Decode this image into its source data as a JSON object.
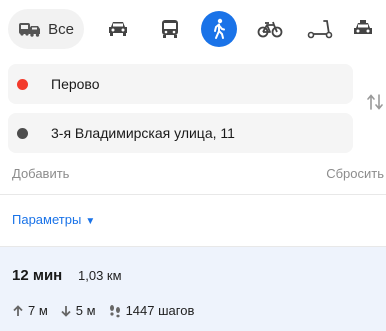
{
  "transport_modes": {
    "all_label": "Все",
    "items": [
      {
        "name": "all",
        "icon": "car-bus-icon"
      },
      {
        "name": "car",
        "icon": "car-icon"
      },
      {
        "name": "public-transport",
        "icon": "bus-icon"
      },
      {
        "name": "walk",
        "icon": "pedestrian-icon",
        "selected": true
      },
      {
        "name": "bicycle",
        "icon": "bicycle-icon"
      },
      {
        "name": "scooter",
        "icon": "scooter-icon"
      },
      {
        "name": "taxi",
        "icon": "taxi-icon"
      }
    ]
  },
  "route_points": {
    "from": "Перово",
    "to": "3-я Владимирская улица, 11"
  },
  "actions": {
    "add": "Добавить",
    "reset": "Сбросить"
  },
  "params_label": "Параметры",
  "route": {
    "time": "12 мин",
    "distance": "1,03 км",
    "ascent": "7 м",
    "descent": "5 м",
    "steps": "1447 шагов"
  },
  "colors": {
    "accent": "#1a73e8",
    "start_point": "#f33a2b",
    "end_point": "#4d4d4d",
    "route_bg": "#eef3fc"
  }
}
